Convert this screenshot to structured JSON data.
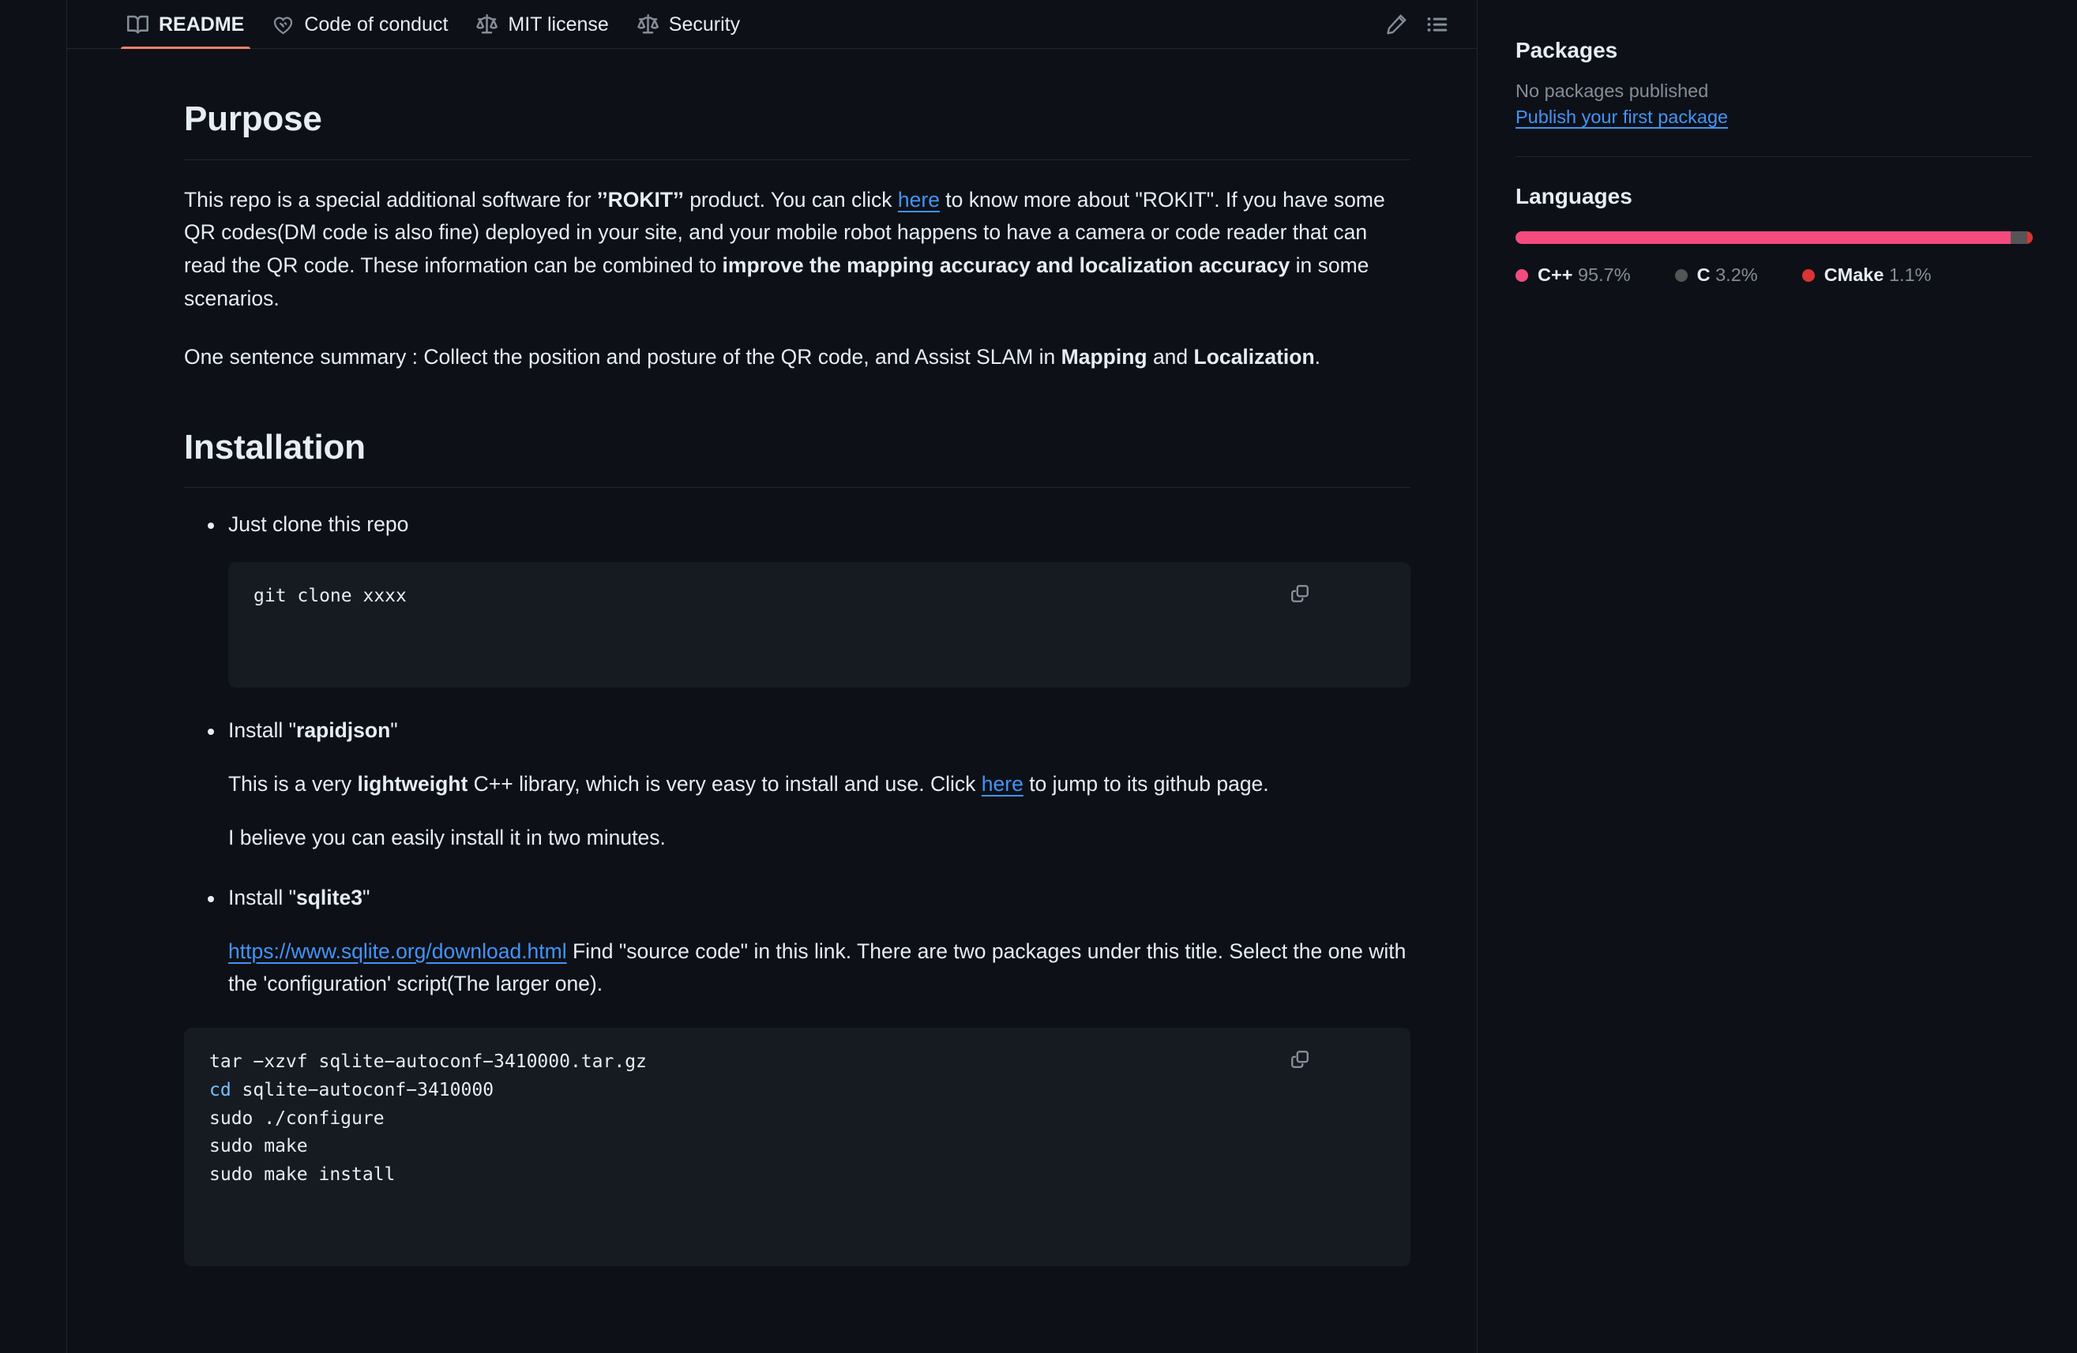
{
  "tabs": [
    {
      "label": "README",
      "icon": "book-icon",
      "active": true
    },
    {
      "label": "Code of conduct",
      "icon": "heart-handshake-icon",
      "active": false
    },
    {
      "label": "MIT license",
      "icon": "law-scale-icon",
      "active": false
    },
    {
      "label": "Security",
      "icon": "law-scale-icon",
      "active": false
    }
  ],
  "toolbar": {
    "edit_icon": "pencil-icon",
    "outline_icon": "list-unordered-icon"
  },
  "readme": {
    "purpose": {
      "heading": "Purpose",
      "p1_a": " This repo is a special additional software for ",
      "p1_rokit": "’’ROKIT’’",
      "p1_b": " product. You can click ",
      "p1_link": "here",
      "p1_c": " to know more about \"ROKIT\". If you have some QR codes(DM code is also fine) deployed in your site, and your mobile robot happens to have a camera or code reader that can read the QR code. These information can be combined to ",
      "p1_bold": "improve the mapping accuracy and localization accuracy",
      "p1_d": " in some scenarios.",
      "p2_a": " One sentence summary : Collect the position and posture of the QR code, and Assist SLAM in ",
      "p2_bold1": "Mapping",
      "p2_b": " and ",
      "p2_bold2": "Localization",
      "p2_c": "."
    },
    "installation": {
      "heading": "Installation",
      "item1": "Just clone this repo",
      "code1": "git clone xxxx",
      "item2_a": "Install \"",
      "item2_bold": "rapidjson",
      "item2_b": "\"",
      "item2_p1_a": "This is a very ",
      "item2_p1_bold": "lightweight",
      "item2_p1_b": " C++ library, which is very easy to install and use. Click ",
      "item2_p1_link": "here",
      "item2_p1_c": " to jump to its github page.",
      "item2_p2": "I believe you can easily install it in two minutes.",
      "item3_a": "Install \"",
      "item3_bold": "sqlite3",
      "item3_b": "\"",
      "item3_link": "https://www.sqlite.org/download.html",
      "item3_p_a": " Find \"source code\" in this link. There are two packages under this title. Select the one with the 'configuration' script(The larger one).",
      "code2_line1": "tar −xzvf sqlite−autoconf−3410000.tar.gz",
      "code2_line2_kw": "cd",
      "code2_line2_rest": " sqlite−autoconf−3410000",
      "code2_line3": "sudo ./configure",
      "code2_line4": "sudo make",
      "code2_line5": "sudo make install"
    },
    "copy_icon": "copy-icon"
  },
  "sidebar": {
    "packages": {
      "heading": "Packages",
      "empty_text": "No packages published",
      "link": "Publish your first package"
    },
    "languages": {
      "heading": "Languages",
      "items": [
        {
          "name": "C++",
          "percent": "95.7%",
          "value": 95.7,
          "color": "#f34b7d"
        },
        {
          "name": "C",
          "percent": "3.2%",
          "value": 3.2,
          "color": "#555555"
        },
        {
          "name": "CMake",
          "percent": "1.1%",
          "value": 1.1,
          "color": "#DA3434"
        }
      ]
    }
  },
  "colors": {
    "background": "#0d1117",
    "border": "#21262d",
    "text": "#e6edf3",
    "muted": "#848d97",
    "link": "#4493f8",
    "accent_tab": "#f78166",
    "code_bg": "#161b22",
    "code_keyword": "#79c0ff"
  }
}
